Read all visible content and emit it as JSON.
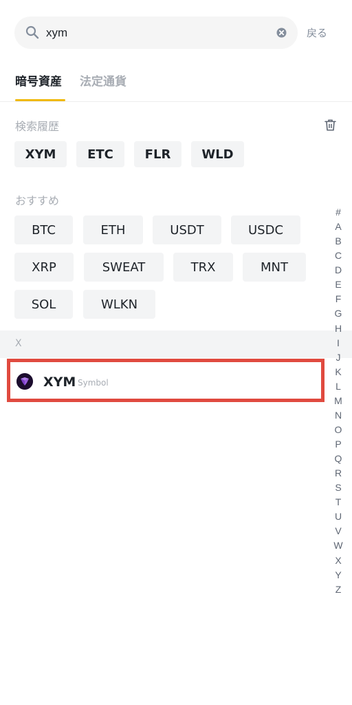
{
  "search": {
    "value": "xym",
    "back_label": "戻る"
  },
  "tabs": [
    {
      "label": "暗号資産"
    },
    {
      "label": "法定通貨"
    }
  ],
  "history": {
    "title": "検索履歴",
    "items": [
      "XYM",
      "ETC",
      "FLR",
      "WLD"
    ]
  },
  "recommended": {
    "title": "おすすめ",
    "items": [
      "BTC",
      "ETH",
      "USDT",
      "USDC",
      "XRP",
      "SWEAT",
      "TRX",
      "MNT",
      "SOL",
      "WLKN"
    ]
  },
  "results": {
    "letter": "X",
    "items": [
      {
        "ticker": "XYM",
        "name": "Symbol"
      }
    ]
  },
  "index_letters": [
    "#",
    "A",
    "B",
    "C",
    "D",
    "E",
    "F",
    "G",
    "H",
    "I",
    "J",
    "K",
    "L",
    "M",
    "N",
    "O",
    "P",
    "Q",
    "R",
    "S",
    "T",
    "U",
    "V",
    "W",
    "X",
    "Y",
    "Z"
  ],
  "colors": {
    "accent": "#f0b90b",
    "highlight_border": "#e04a3f",
    "chip_bg": "#f3f4f5"
  }
}
